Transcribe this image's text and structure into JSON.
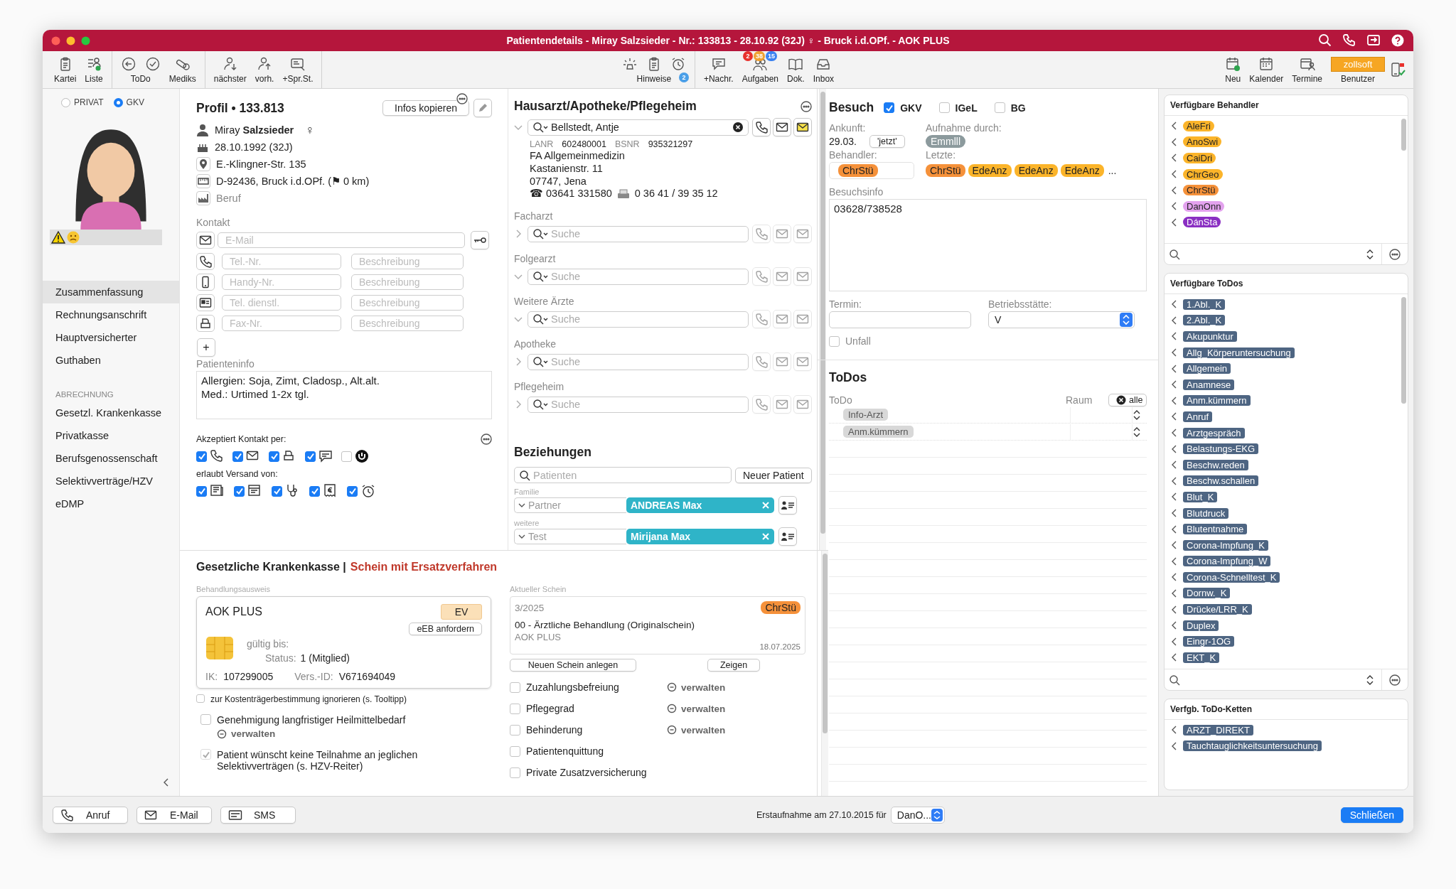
{
  "window": {
    "title": "Patientendetails - Miray Salzsieder - Nr.: 133813 - 28.10.92 (32J) ♀ - Bruck i.d.OPf. - AOK PLUS"
  },
  "toolbar": {
    "left": [
      {
        "label": "Kartei"
      },
      {
        "label": "Liste"
      },
      {
        "label": "ToDo"
      },
      {
        "label": "Mediks"
      },
      {
        "label": "nächster"
      },
      {
        "label": "vorh."
      },
      {
        "label": "+Spr.St."
      }
    ],
    "center": [
      {
        "label": "Hinweise",
        "badges": [
          {
            "text": "2",
            "color": "#4a9fe8"
          }
        ]
      },
      {
        "label": "+Nachr."
      },
      {
        "label": "Aufgaben",
        "badges": [
          {
            "text": "2",
            "color": "#e8302c"
          },
          {
            "text": "38",
            "color": "#f0a030"
          },
          {
            "text": "15",
            "color": "#3b82f0"
          }
        ]
      },
      {
        "label": "Dok."
      },
      {
        "label": "Inbox"
      }
    ],
    "right": [
      {
        "label": "Neu"
      },
      {
        "label": "Kalender"
      },
      {
        "label": "Termine"
      },
      {
        "label": "Benutzer",
        "account": "zollsoft"
      }
    ]
  },
  "sidebar": {
    "insurance": [
      {
        "label": "PRIVAT",
        "selected": false
      },
      {
        "label": "GKV",
        "selected": true
      }
    ],
    "nav": [
      {
        "kind": "item",
        "label": "Zusammenfassung",
        "selected": true
      },
      {
        "kind": "item",
        "label": "Rechnungsanschrift",
        "selected": false
      },
      {
        "kind": "item",
        "label": "Hauptversicherter",
        "selected": false
      },
      {
        "kind": "item",
        "label": "Guthaben",
        "selected": false
      },
      {
        "kind": "header",
        "label": "ABRECHNUNG"
      },
      {
        "kind": "item",
        "label": "Gesetzl. Krankenkasse",
        "selected": false
      },
      {
        "kind": "item",
        "label": "Privatkasse",
        "selected": false
      },
      {
        "kind": "item",
        "label": "Berufsgenossenschaft",
        "selected": false
      },
      {
        "kind": "item",
        "label": "Selektivverträge/HZV",
        "selected": false
      },
      {
        "kind": "item",
        "label": "eDMP",
        "selected": false
      }
    ]
  },
  "profile": {
    "title": "Profil • 133.813",
    "copy_button": "Infos kopieren",
    "name": "Miray **Salzsieder**",
    "gender": "♀",
    "birth": "28.10.1992 (32J)",
    "street": "E.-Klingner-Str. 135",
    "city": "D-92436, Bruck i.d.OPf. (⚑ 0 km)",
    "job_placeholder": "Beruf",
    "contact_label": "Kontakt",
    "email": {
      "placeholder": "E-Mail"
    },
    "phones": [
      {
        "placeholder": "Tel.-Nr.",
        "note_placeholder": "Beschreibung"
      },
      {
        "placeholder": "Handy-Nr.",
        "note_placeholder": "Beschreibung"
      },
      {
        "placeholder": "Tel. dienstl.",
        "note_placeholder": "Beschreibung"
      },
      {
        "placeholder": "Fax-Nr.",
        "note_placeholder": "Beschreibung"
      }
    ],
    "add_button": "+",
    "info_label": "Patienteninfo",
    "info": "Allergien: Soja, Zimt, Cladosp., Alt.alt.\nMed.: Urtimed 1-2x tgl.",
    "accepts_label": "Akzeptiert Kontakt per:",
    "accepts": [
      {
        "checked": true
      },
      {
        "checked": true
      },
      {
        "checked": true
      },
      {
        "checked": true
      },
      {
        "checked": false
      }
    ],
    "dispatch_label": "erlaubt Versand von:",
    "dispatch": [
      {
        "checked": true
      },
      {
        "checked": true
      },
      {
        "checked": true
      },
      {
        "checked": true
      },
      {
        "checked": true
      }
    ]
  },
  "physicians": {
    "title": "Hausarzt/Apotheke/Pflegeheim",
    "entries": [
      {
        "expanded": true,
        "value": "Bellstedt, Antje",
        "details": {
          "lanr_label": "LANR",
          "lanr": "602480001",
          "bsnr_label": "BSNR",
          "bsnr": "935321297",
          "lines": [
            "FA Allgemeinmedizin",
            "Kastanienstr.  11",
            "07747, Jena"
          ],
          "phone": "☎ 03641 331580",
          "fax": "0 36 41 / 39 35 12"
        }
      },
      {
        "label": "Facharzt",
        "expanded": false,
        "placeholder": "Suche"
      },
      {
        "label": "Folgearzt",
        "expanded": true,
        "placeholder": "Suche"
      },
      {
        "label": "Weitere Ärzte",
        "expanded": true,
        "placeholder": "Suche"
      },
      {
        "label": "Apotheke",
        "expanded": false,
        "placeholder": "Suche"
      },
      {
        "label": "Pflegeheim",
        "expanded": false,
        "placeholder": "Suche"
      }
    ]
  },
  "relations": {
    "title": "Beziehungen",
    "search_placeholder": "Patienten",
    "new_button": "Neuer Patient",
    "groups": [
      {
        "label": "Familie",
        "relation": "Partner",
        "person": "ANDREAS Max"
      },
      {
        "label": "weitere",
        "relation": "Test",
        "person": "Mirijana Max"
      }
    ]
  },
  "gkv": {
    "title": "Gesetzliche Krankenkasse |",
    "subtitle": "Schein mit Ersatzverfahren",
    "card_label": "Behandlungsausweis",
    "card": {
      "insurer": "AOK PLUS",
      "badge": "EV",
      "request_button": "eEB anfordern",
      "valid_label": "gültig bis:",
      "status_label": "Status:",
      "status": "1 (Mitglied)",
      "ik_label": "IK:",
      "ik": "107299005",
      "id_label": "Vers.-ID:",
      "id": "V671694049"
    },
    "options": [
      {
        "label": "zur Kostenträgerbestimmung ignorieren (s. Tooltipp)",
        "checked": false,
        "kind": "small"
      },
      {
        "label": "Genehmigung langfristiger Heilmittelbedarf",
        "checked": false,
        "kind": "normal",
        "link": "verwalten"
      },
      {
        "label": "Patient wünscht keine Teilnahme an jeglichen Selektivverträgen (s. HZV-Reiter)",
        "checked": true,
        "kind": "normal"
      }
    ],
    "current_label": "Aktueller Schein",
    "current": {
      "quarter": "3/2025",
      "doctor": {
        "text": "ChrStü",
        "color": "#f5913a"
      },
      "type": "00 - Ärztliche Behandlung (Originalschein)",
      "insurer": "AOK PLUS",
      "date": "18.07.2025"
    },
    "new_button": "Neuen Schein anlegen",
    "show_button": "Zeigen",
    "flags": [
      {
        "label": "Zuzahlungsbefreiung",
        "checked": false,
        "link": "verwalten"
      },
      {
        "label": "Pflegegrad",
        "checked": false,
        "link": "verwalten"
      },
      {
        "label": "Behinderung",
        "checked": false,
        "link": "verwalten"
      },
      {
        "label": "Patientenquittung",
        "checked": false
      },
      {
        "label": "Private Zusatzversicherung",
        "checked": false
      }
    ]
  },
  "visit": {
    "title": "Besuch",
    "types": [
      {
        "label": "GKV",
        "checked": true
      },
      {
        "label": "IGeL",
        "checked": false
      },
      {
        "label": "BG",
        "checked": false
      }
    ],
    "arrival_label": "Ankunft:",
    "arrival": "29.03.",
    "now_button": "'jetzt'",
    "admission_label": "Aufnahme durch:",
    "admission": "Emmlll",
    "doctor_label": "Behandler:",
    "doctor": {
      "text": "ChrStü",
      "color": "#f5913a"
    },
    "recent_label": "Letzte:",
    "recent": [
      {
        "text": "ChrStü",
        "color": "#f5913a"
      },
      {
        "text": "EdeAnz",
        "color": "#fbb42a"
      },
      {
        "text": "EdeAnz",
        "color": "#fbb42a"
      },
      {
        "text": "EdeAnz",
        "color": "#fbb42a"
      }
    ],
    "recent_more": "...",
    "info_label": "Besuchsinfo",
    "info": "03628/738528",
    "appointment_label": "Termin:",
    "site_label": "Betriebsstätte:",
    "site": "V",
    "accident": {
      "label": "Unfall",
      "checked": false
    }
  },
  "todos": {
    "title": "ToDos",
    "todo_header": "ToDo",
    "room_header": "Raum",
    "all_button": "alle",
    "rows": [
      {
        "todo": "Info-Arzt"
      },
      {
        "todo": "Anm.kümmern"
      }
    ]
  },
  "panels": {
    "doctors": {
      "title": "Verfügbare Behandler",
      "items": [
        {
          "text": "AleFri",
          "color": "#fbb42a"
        },
        {
          "text": "AnoSwi",
          "color": "#fbb42a"
        },
        {
          "text": "CaiDri",
          "color": "#fbb42a"
        },
        {
          "text": "ChrGeo",
          "color": "#fbb42a"
        },
        {
          "text": "ChrStü",
          "color": "#f5913a"
        },
        {
          "text": "DanOnn",
          "color": "#e3a2ee"
        },
        {
          "text": "DánSta",
          "color": "#8a2fc2"
        }
      ]
    },
    "todos": {
      "title": "Verfügbare ToDos",
      "items": [
        "1.Abl._K",
        "2.Abl._K",
        "Akupunktur",
        "Allg_Körperuntersuchung",
        "Allgemein",
        "Anamnese",
        "Anm.kümmern",
        "Anruf",
        "Arztgespräch",
        "Belastungs-EKG",
        "Beschw.reden",
        "Beschw.schallen",
        "Blut_K",
        "Blutdruck",
        "Blutentnahme",
        "Corona-Impfung_K",
        "Corona-Impfung_W",
        "Corona-Schnelltest_K",
        "Dornw._K",
        "Drücke/LRR_K",
        "Duplex",
        "Eingr-1OG",
        "EKT_K"
      ]
    },
    "chains": {
      "title": "Verfgb. ToDo-Ketten",
      "items": [
        "ARZT_DIREKT",
        "Tauchtauglichkeitsuntersuchung"
      ]
    }
  },
  "bottom_bar": {
    "buttons": [
      "Anruf",
      "E-Mail",
      "SMS"
    ],
    "first_visit": "Erstaufnahme am 27.10.2015 für",
    "first_visit_by": "DanO...",
    "close_button": "Schließen"
  }
}
